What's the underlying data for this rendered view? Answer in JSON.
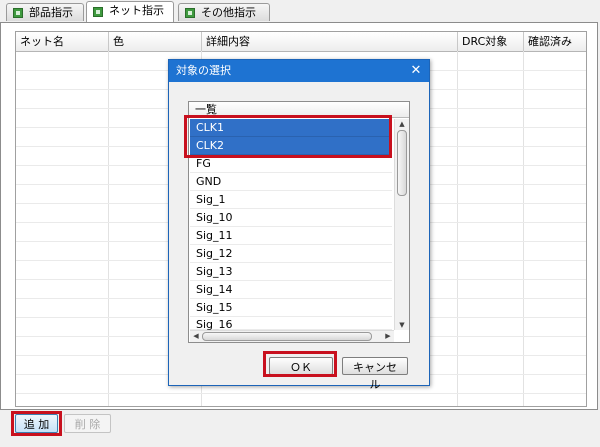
{
  "tabs": [
    {
      "label": "部品指示",
      "icon": "plugin-icon"
    },
    {
      "label": "ネット指示",
      "icon": "plugin-icon",
      "active": true
    },
    {
      "label": "その他指示",
      "icon": "plugin-icon"
    }
  ],
  "table": {
    "columns": [
      "ネット名",
      "色",
      "詳細内容",
      "DRC対象",
      "確認済み"
    ]
  },
  "dialog": {
    "title": "対象の選択",
    "close_glyph": "✕",
    "list": {
      "header": "一覧",
      "items": [
        "CLK1",
        "CLK2",
        "FG",
        "GND",
        "Sig_1",
        "Sig_10",
        "Sig_11",
        "Sig_12",
        "Sig_13",
        "Sig_14",
        "Sig_15",
        "Sig_16"
      ],
      "selected": [
        "CLK1",
        "CLK2"
      ]
    },
    "ok_label": "ＯＫ",
    "cancel_label": "キャンセル"
  },
  "buttons": {
    "add_label": "追 加",
    "delete_label": "削 除"
  },
  "colors": {
    "highlight": "#c8101e",
    "selection": "#3070c7",
    "title_bar": "#1e73d2"
  }
}
